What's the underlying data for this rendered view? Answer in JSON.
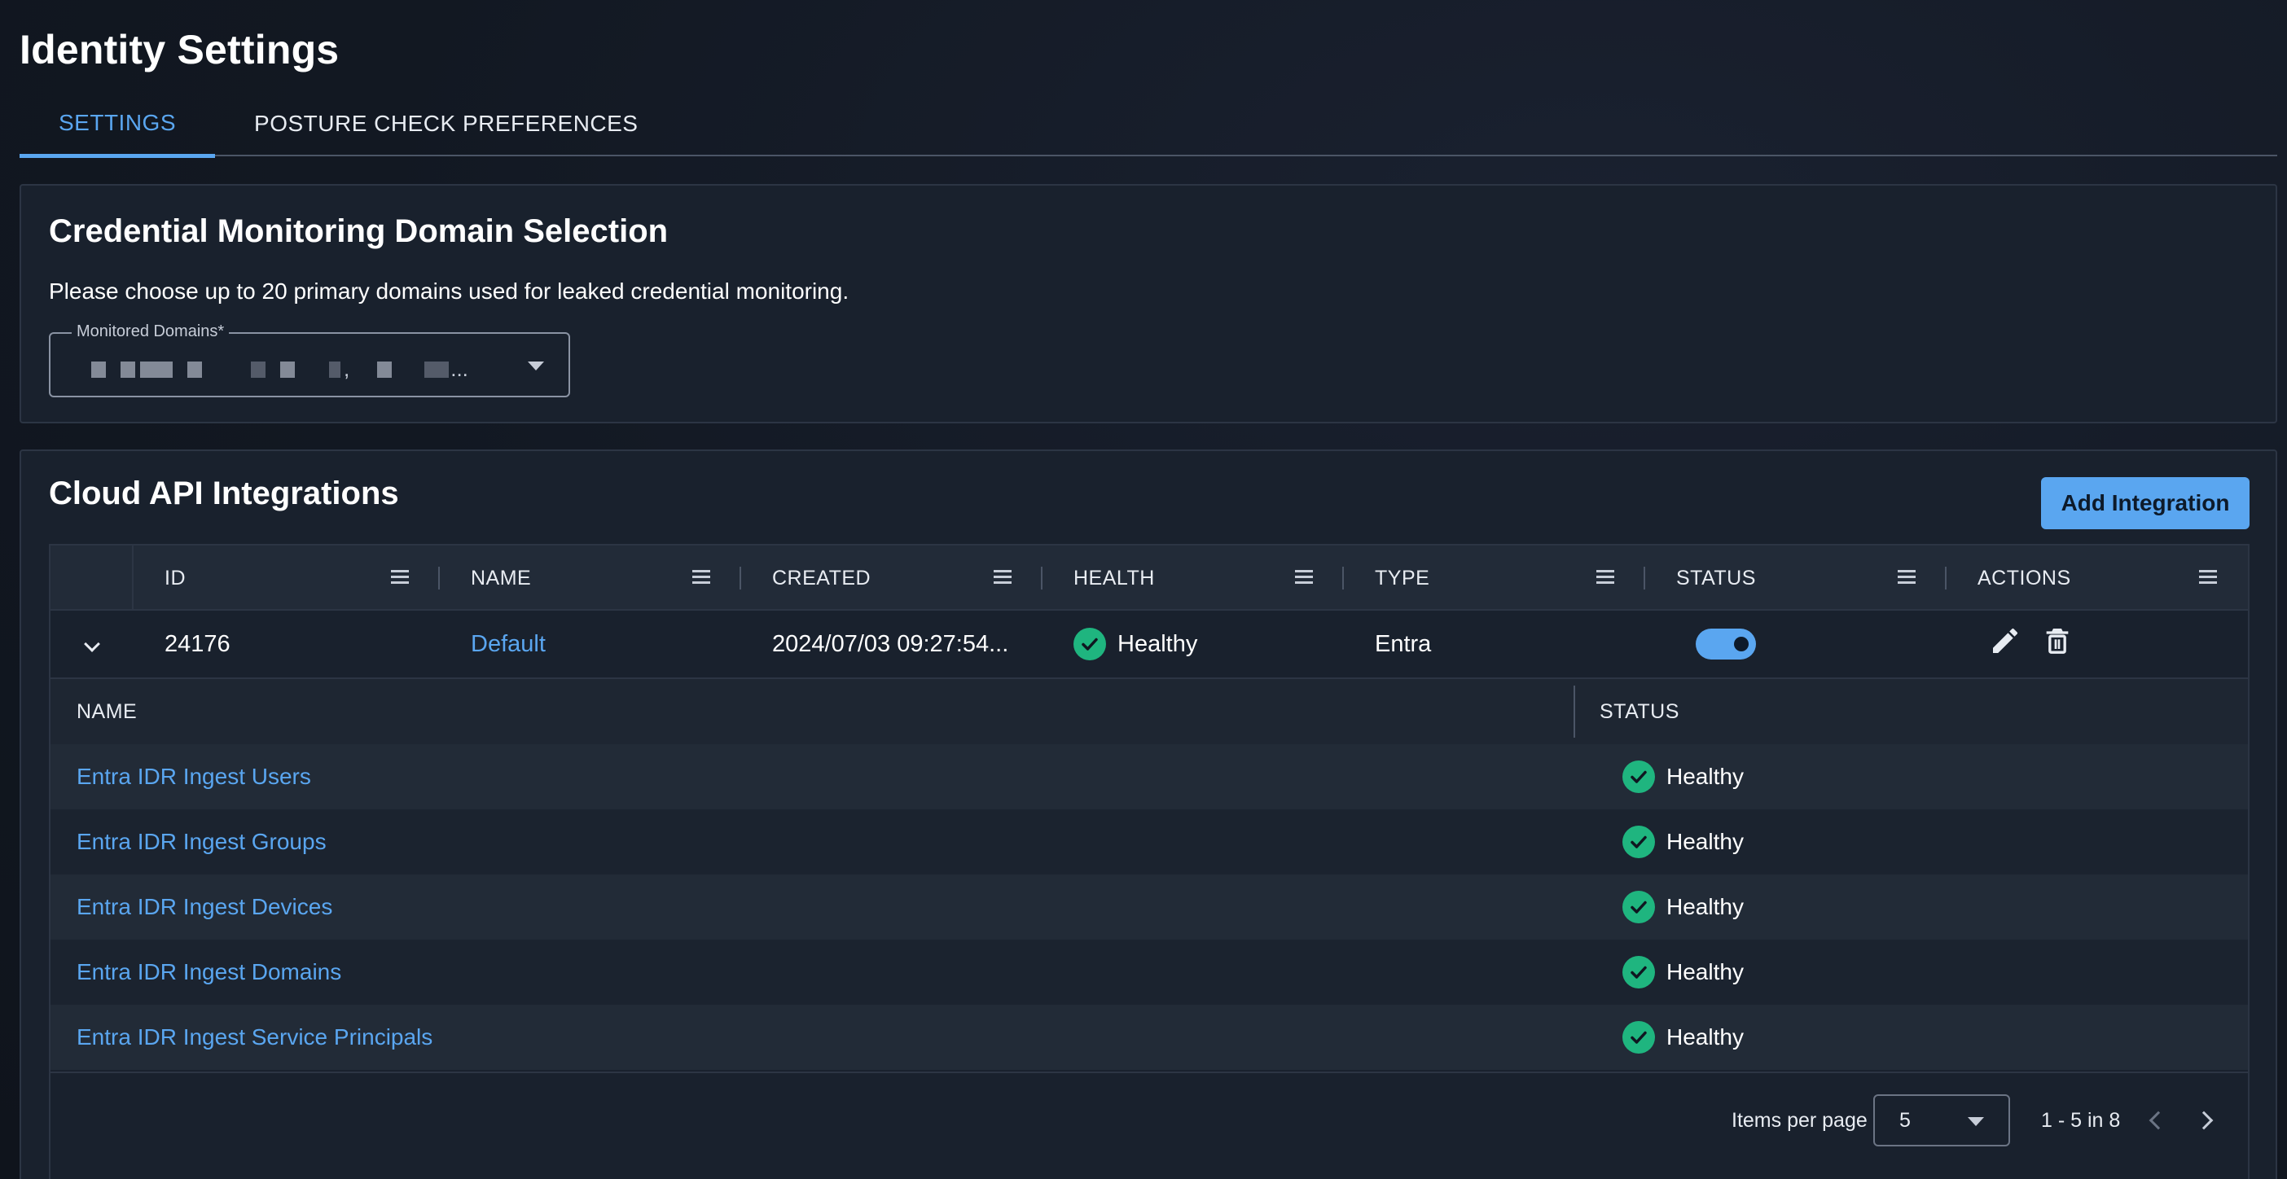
{
  "page": {
    "title": "Identity Settings"
  },
  "tabs": [
    {
      "label": "SETTINGS",
      "active": true
    },
    {
      "label": "POSTURE CHECK PREFERENCES",
      "active": false
    }
  ],
  "domains_section": {
    "title": "Credential Monitoring Domain Selection",
    "description": "Please choose up to 20 primary domains used for leaked credential monitoring.",
    "field_label": "Monitored Domains*",
    "field_value_note": "redacted",
    "field_value_suffix": "..."
  },
  "cloud_section": {
    "title": "Cloud API Integrations",
    "add_button": "Add Integration",
    "columns": [
      "ID",
      "NAME",
      "CREATED",
      "HEALTH",
      "TYPE",
      "STATUS",
      "ACTIONS"
    ],
    "row": {
      "id": "24176",
      "name": "Default",
      "created": "2024/07/03 09:27:54...",
      "health": "Healthy",
      "type": "Entra",
      "status_enabled": true
    },
    "sub_columns": [
      "NAME",
      "STATUS"
    ],
    "sub_rows": [
      {
        "name": "Entra IDR Ingest Users",
        "status": "Healthy"
      },
      {
        "name": "Entra IDR Ingest Groups",
        "status": "Healthy"
      },
      {
        "name": "Entra IDR Ingest Devices",
        "status": "Healthy"
      },
      {
        "name": "Entra IDR Ingest Domains",
        "status": "Healthy"
      },
      {
        "name": "Entra IDR Ingest Service Principals",
        "status": "Healthy"
      }
    ],
    "pagination": {
      "items_per_page_label": "Items per page",
      "items_per_page": "5",
      "range": "1 - 5 in 8"
    }
  },
  "icons": {
    "health": "check-circle-icon",
    "edit": "pencil-icon",
    "delete": "trash-icon",
    "expand": "chevron-down-icon",
    "column_menu": "menu-icon"
  },
  "colors": {
    "accent": "#5aa6f0",
    "healthy": "#1fb57f",
    "background": "#121822",
    "panel": "#19212d"
  }
}
